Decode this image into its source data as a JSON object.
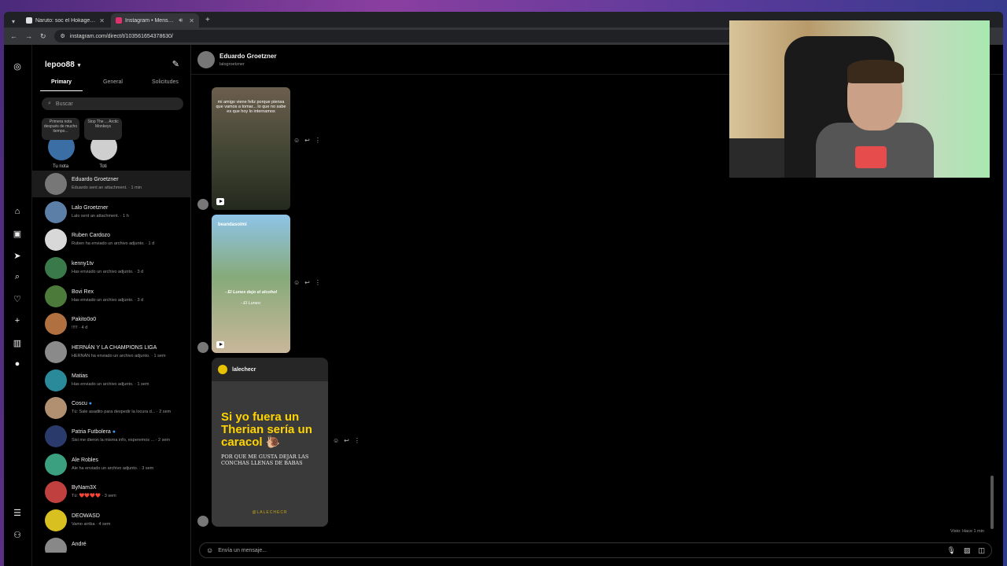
{
  "browser": {
    "tabs": [
      {
        "label": "Naruto: soc el Hokage del strea...",
        "favicon_color": "#e0e0e0",
        "active": false
      },
      {
        "label": "Instagram • Mensajes",
        "favicon_color": "#e1306c",
        "active": true
      }
    ],
    "url": "instagram.com/direct/t/103561654378630/"
  },
  "sidebar": {
    "username": "lepoo88",
    "tabs": [
      "Primary",
      "General",
      "Solicitudes"
    ],
    "search_placeholder": "Buscar",
    "notes": [
      {
        "bubble": "Primera nota después de mucho tiempo...",
        "name": "Tu nota",
        "color": "#3a6ea5"
      },
      {
        "bubble": "Stop The ... Arctic Monkeys",
        "name": "Toti",
        "color": "#cfcfcf"
      }
    ],
    "conversations": [
      {
        "name": "Eduardo Groetzner",
        "preview": "Eduardo sent an attachment. · 1 min",
        "color": "#777777",
        "selected": true
      },
      {
        "name": "Lalo Groetzner",
        "preview": "Lalo sent an attachment. · 1 h",
        "color": "#5c7fa8"
      },
      {
        "name": "Ruben Cardozo",
        "preview": "Ruben ha enviado un archivo adjunto. · 1 d",
        "color": "#d8d8d8"
      },
      {
        "name": "kenny1tv",
        "preview": "Has enviado un archivo adjunto. · 3 d",
        "color": "#3a7a4a"
      },
      {
        "name": "Bovi Rex",
        "preview": "Has enviado un archivo adjunto. · 3 d",
        "color": "#4c7a3a"
      },
      {
        "name": "Pakito0o0",
        "preview": "!!!!! · 4 d",
        "color": "#b07040"
      },
      {
        "name": "HERNÁN Y LA CHAMPIONS LIGA",
        "preview": "HERNÁN ha enviado un archivo adjunto. · 1 sem",
        "color": "#8a8a8a"
      },
      {
        "name": "Matias",
        "preview": "Has enviado un archivo adjunto. · 1 sem",
        "color": "#2a8a9a"
      },
      {
        "name": "Coscu",
        "preview": "Tú: Sale asadito para despedir la locura d... · 2 sem",
        "color": "#b09070",
        "verified": true
      },
      {
        "name": "Patria Futbolera",
        "preview": "Sisi me dieron la misma info, esperemos ... · 2 sem",
        "color": "#2a3a6a",
        "verified": true
      },
      {
        "name": "Ale Robles",
        "preview": "Ale ha enviado un archivo adjunto. · 3 sem",
        "color": "#3aa080"
      },
      {
        "name": "ByNam3X",
        "preview": "Tú: ❤️❤️❤️❤️ · 3 sem",
        "color": "#c04040"
      },
      {
        "name": "DEOWASD",
        "preview": "Vamo arriba · 4 sem",
        "color": "#d8c020"
      },
      {
        "name": "André",
        "preview": "",
        "color": "#888888"
      }
    ]
  },
  "chat": {
    "name": "Eduardo Groetzner",
    "username": "lalogroetzner",
    "reel1_caption": "mi amigo viene feliz porque piensa que vamos a tomar... lo que no sabe es que hoy lo internamos",
    "reel2_header": "beandasolmi",
    "reel2_caption1": "- El Lunes dejo el alcohol",
    "reel2_caption2": "- El Lunes:",
    "post_author": "lalechecr",
    "post_title": "Si yo fuera un Therian sería un caracol 🐌",
    "post_subtitle": "POR QUE ME GUSTA DEJAR LAS CONCHAS LLENAS DE BABAS",
    "post_footer": "@LALECHECR",
    "seen": "Visto: Hace 1 min",
    "composer_placeholder": "Envía un mensaje..."
  },
  "colors": {
    "background": "#000000",
    "accent_yellow": "#ffd400"
  }
}
